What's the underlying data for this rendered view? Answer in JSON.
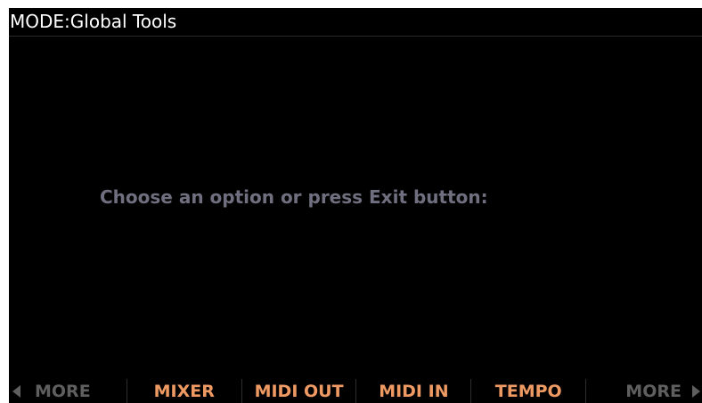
{
  "title_bar": {
    "text": "MODE:Global Tools"
  },
  "prompt": {
    "text": "Choose an option or press Exit button:"
  },
  "softkeys": [
    {
      "label": "MORE"
    },
    {
      "label": "MIXER"
    },
    {
      "label": "MIDI OUT"
    },
    {
      "label": "MIDI IN"
    },
    {
      "label": "TEMPO"
    },
    {
      "label": "MORE"
    }
  ],
  "colors": {
    "background": "#000000",
    "title_text": "#ffffff",
    "prompt_text": "#6f6f7f",
    "softkey_active": "#ef9a63",
    "softkey_inactive": "#5f5f5f"
  },
  "icons": {
    "prev_page": "triangle-left-icon",
    "next_page": "triangle-right-icon"
  }
}
